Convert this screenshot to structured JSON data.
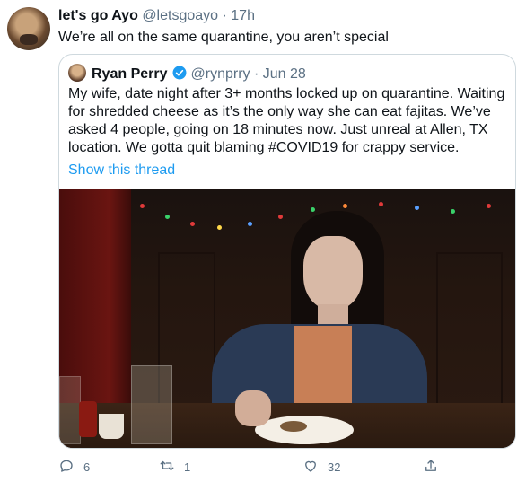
{
  "tweet": {
    "author_name": "let's go Ayo",
    "author_handle": "@letsgoayo",
    "separator": "·",
    "time": "17h",
    "text": "We’re all on the same quarantine, you aren’t special"
  },
  "quoted": {
    "author_name": "Ryan Perry",
    "author_handle": "@rynprry",
    "separator": "·",
    "time": "Jun 28",
    "text": "My wife, date night after 3+ months locked up on quarantine. Waiting for shredded cheese as it’s the only way she can eat fajitas. We’ve asked 4 people, going on 18 minutes now. Just unreal at Allen, TX location. We gotta quit blaming #COVID19 for crappy service.",
    "link_text": "Show this thread",
    "verified": true
  },
  "actions": {
    "reply_count": "6",
    "retweet_count": "1",
    "like_count": "32",
    "icons": [
      "reply-icon",
      "retweet-icon",
      "like-icon",
      "share-icon"
    ]
  },
  "colors": {
    "accent": "#1d9bf0",
    "secondary_text": "#5b7083",
    "border": "#cfd9de"
  }
}
